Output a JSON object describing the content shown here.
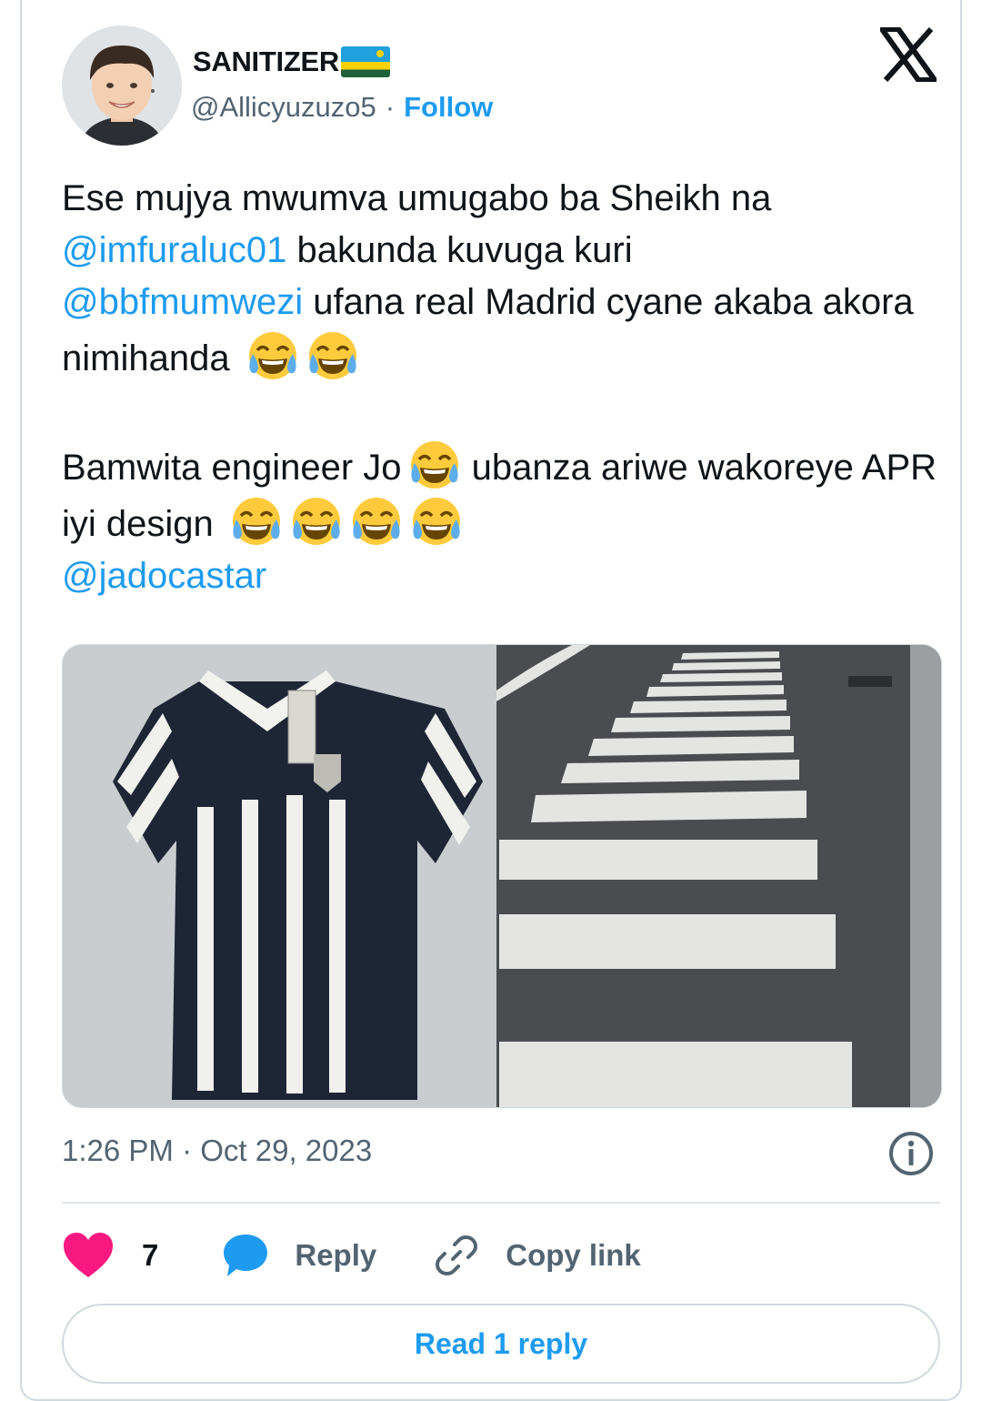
{
  "author": {
    "name": "SANITIZER",
    "handle": "@Allicyuzuzo5",
    "separator": "·",
    "follow_label": "Follow",
    "flag_icon": "rwanda-flag-icon"
  },
  "tweet": {
    "p1_t1": "Ese mujya mwumva umugabo ba Sheikh na",
    "p1_m1": "@imfuraluc01",
    "p1_t2": " bakunda kuvuga kuri",
    "p1_m2": "@bbfmumwezi",
    "p1_t3": " ufana real Madrid cyane akaba akora nimihanda",
    "p2_t1": "Bamwita engineer Jo",
    "p2_t2": " ubanza ariwe wakoreye APR iyi design",
    "p2_m1": "@jadocastar",
    "emoji_icon": "face-with-tears-of-joy-icon"
  },
  "meta": {
    "time": "1:26 PM",
    "separator": "·",
    "date": "Oct 29, 2023"
  },
  "actions": {
    "like_count": "7",
    "reply_label": "Reply",
    "copy_label": "Copy link"
  },
  "read_replies_label": "Read 1 reply",
  "colors": {
    "accent": "#1d9bf0",
    "like": "#f91880",
    "secondary_text": "#536471",
    "border": "#cfd9de"
  }
}
